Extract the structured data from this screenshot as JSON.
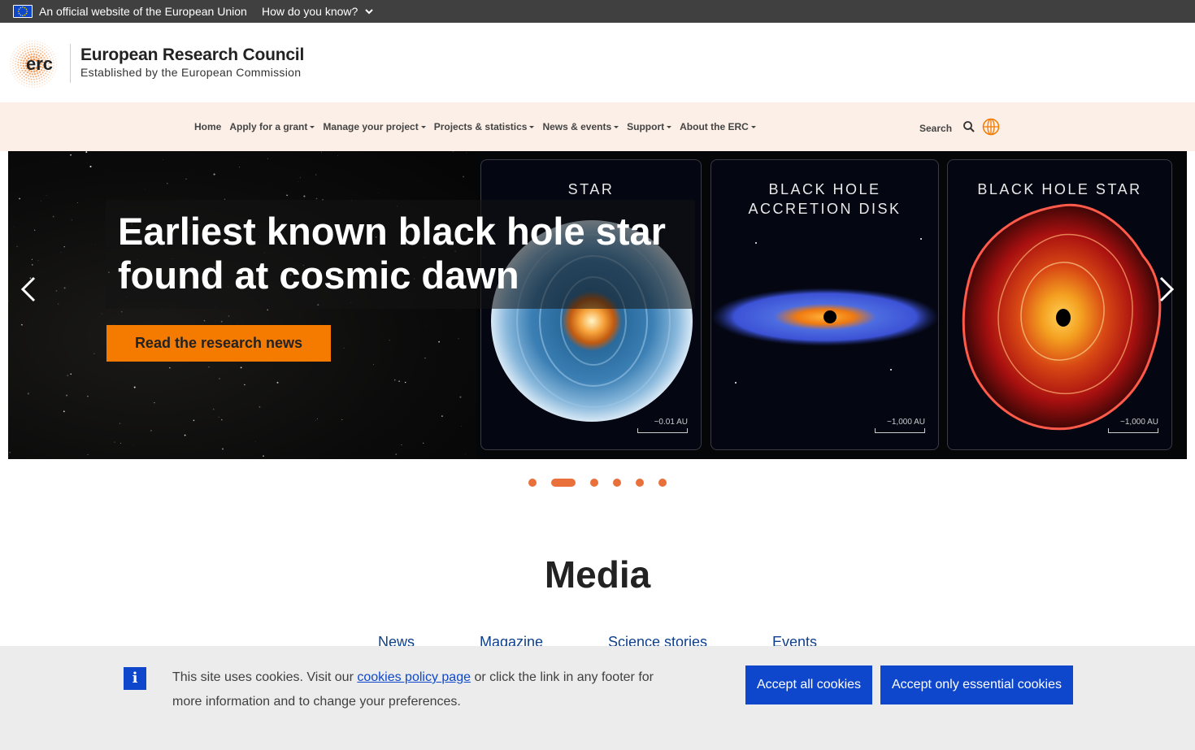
{
  "eu_bar": {
    "official_text": "An official website of the European Union",
    "how_know": "How do you know?"
  },
  "header": {
    "logo_text": "erc",
    "title": "European Research Council",
    "subtitle": "Established by the European Commission"
  },
  "nav": {
    "items": [
      {
        "label": "Home",
        "dropdown": false
      },
      {
        "label": "Apply for a grant",
        "dropdown": true
      },
      {
        "label": "Manage your project",
        "dropdown": true
      },
      {
        "label": "Projects & statistics",
        "dropdown": true
      },
      {
        "label": "News & events",
        "dropdown": true
      },
      {
        "label": "Support",
        "dropdown": true
      },
      {
        "label": "About the ERC",
        "dropdown": true
      }
    ],
    "search_label": "Search"
  },
  "hero": {
    "headline": "Earliest known black hole star found at cosmic dawn",
    "cta_label": "Read the research news",
    "panels": [
      {
        "title": "STAR",
        "scale": "~0.01 AU"
      },
      {
        "title": "BLACK HOLE ACCRETION DISK",
        "scale": "~1,000 AU"
      },
      {
        "title": "BLACK HOLE STAR",
        "scale": "~1,000 AU"
      }
    ],
    "slide_count": 6,
    "active_slide": 2
  },
  "media": {
    "title": "Media",
    "tabs": [
      "News",
      "Magazine",
      "Science stories",
      "Events"
    ]
  },
  "cookie": {
    "text_before": "This site uses cookies. Visit our ",
    "link_text": "cookies policy page",
    "text_after": " or click the link in any footer for more information and to change your preferences.",
    "accept_all": "Accept all cookies",
    "accept_essential": "Accept only essential cookies"
  },
  "colors": {
    "eu_bar": "#404040",
    "nav_bg": "#fcefe7",
    "cta": "#f47a00",
    "dot": "#e9703a",
    "eu_blue": "#0e47cb"
  }
}
